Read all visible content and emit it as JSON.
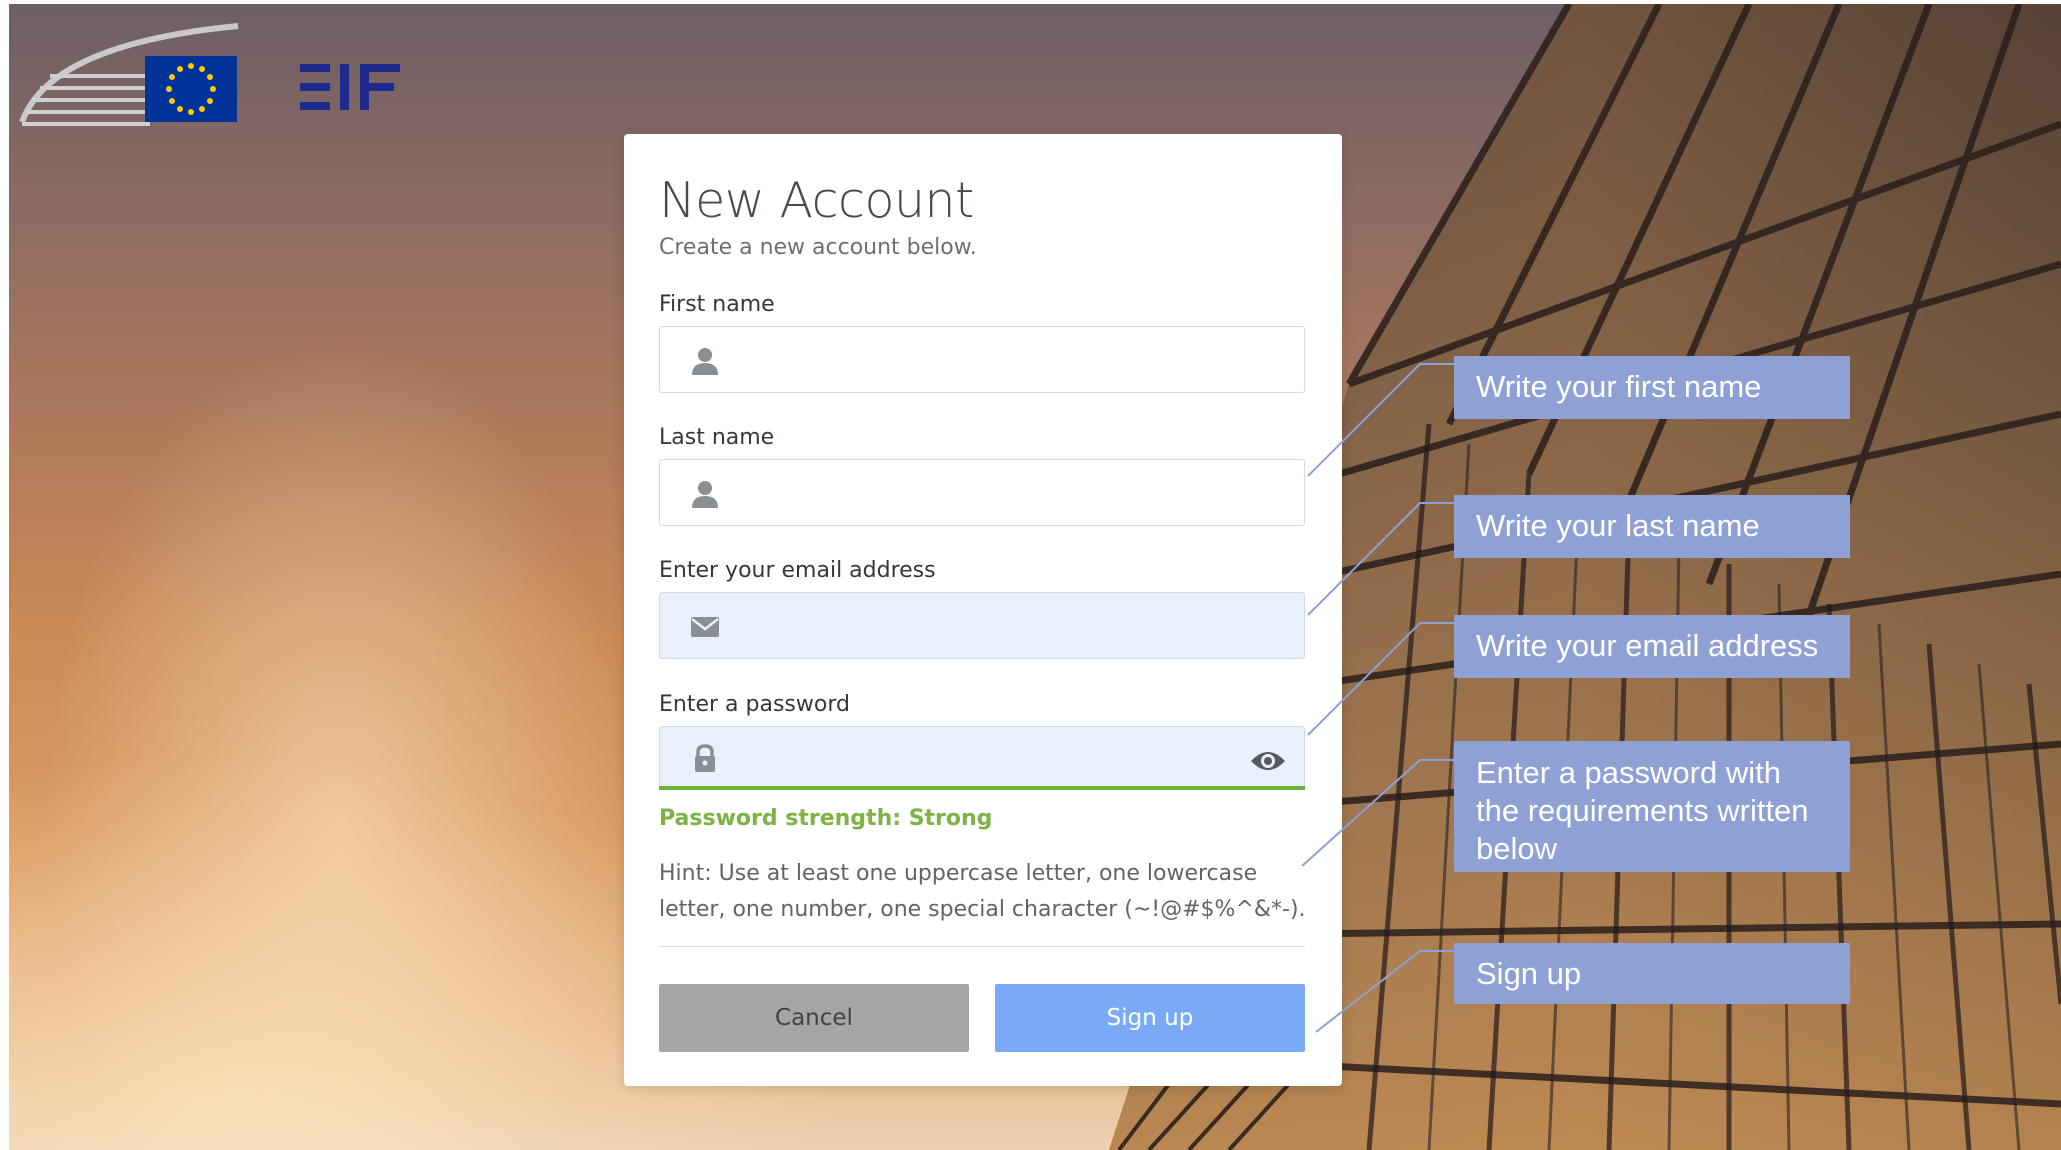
{
  "form": {
    "title": "New Account",
    "subtitle": "Create a new account below.",
    "first_name": {
      "label": "First name",
      "value": "",
      "icon": "user-icon"
    },
    "last_name": {
      "label": "Last name",
      "value": "",
      "icon": "user-icon"
    },
    "email": {
      "label": "Enter your email address",
      "value": "",
      "icon": "envelope-icon"
    },
    "password": {
      "label": "Enter a password",
      "value": "",
      "icon": "lock-icon",
      "toggle_icon": "eye-icon"
    },
    "strength": "Password strength: Strong",
    "hint": "Hint: Use at least one uppercase letter, one lowercase letter, one number, one special character (~!@#$%^&*-).",
    "cancel_label": "Cancel",
    "signup_label": "Sign up"
  },
  "callouts": [
    "Write your first name",
    "Write your last name",
    "Write your email address",
    "Enter a password with the requirements written below",
    "Sign up"
  ],
  "colors": {
    "callout_bg": "#8ea0d4",
    "strength_green": "#7cb342",
    "signup_blue": "#7aaaf6",
    "cancel_gray": "#a4a5a6",
    "autofill_bg": "#e8f0fe",
    "eu_blue": "#003399",
    "eu_star_yellow": "#ffcc00",
    "eif_blue": "#1e2a8c"
  }
}
